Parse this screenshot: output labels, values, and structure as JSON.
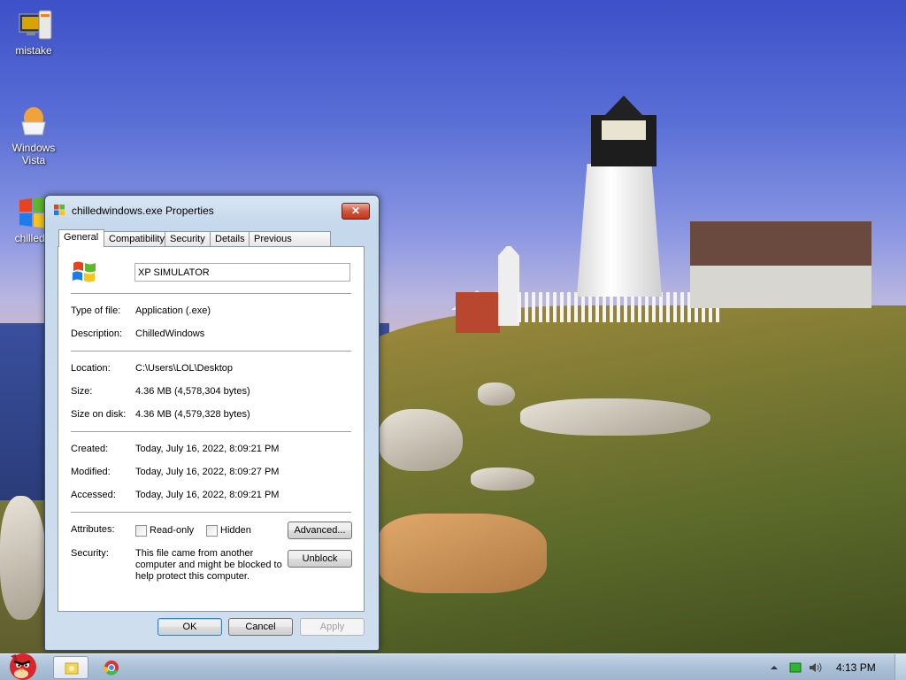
{
  "desktop": {
    "icons": [
      {
        "label": "mistake"
      },
      {
        "label": "Windows Vista"
      },
      {
        "label": "chilledw"
      }
    ]
  },
  "window": {
    "title": "chilledwindows.exe Properties",
    "close_label": "✕",
    "tabs": [
      "General",
      "Compatibility",
      "Security",
      "Details",
      "Previous Versions"
    ],
    "file_name": "XP SIMULATOR",
    "fields": {
      "type_label": "Type of file:",
      "type_value": "Application (.exe)",
      "description_label": "Description:",
      "description_value": "ChilledWindows",
      "location_label": "Location:",
      "location_value": "C:\\Users\\LOL\\Desktop",
      "size_label": "Size:",
      "size_value": "4.36 MB (4,578,304 bytes)",
      "size_on_disk_label": "Size on disk:",
      "size_on_disk_value": "4.36 MB (4,579,328 bytes)",
      "created_label": "Created:",
      "created_value": "Today, July 16, 2022, 8:09:21 PM",
      "modified_label": "Modified:",
      "modified_value": "Today, July 16, 2022, 8:09:27 PM",
      "accessed_label": "Accessed:",
      "accessed_value": "Today, July 16, 2022, 8:09:21 PM",
      "attributes_label": "Attributes:",
      "readonly_label": "Read-only",
      "hidden_label": "Hidden",
      "advanced_label": "Advanced...",
      "security_label": "Security:",
      "security_text": "This file came from another computer and might be blocked to help protect this computer.",
      "unblock_label": "Unblock"
    },
    "buttons": {
      "ok": "OK",
      "cancel": "Cancel",
      "apply": "Apply"
    }
  },
  "taskbar": {
    "clock": "4:13 PM"
  },
  "colors": {
    "accent": "#3c7fb1",
    "close_red": "#c2351c",
    "taskbar": "#aac0d6"
  }
}
